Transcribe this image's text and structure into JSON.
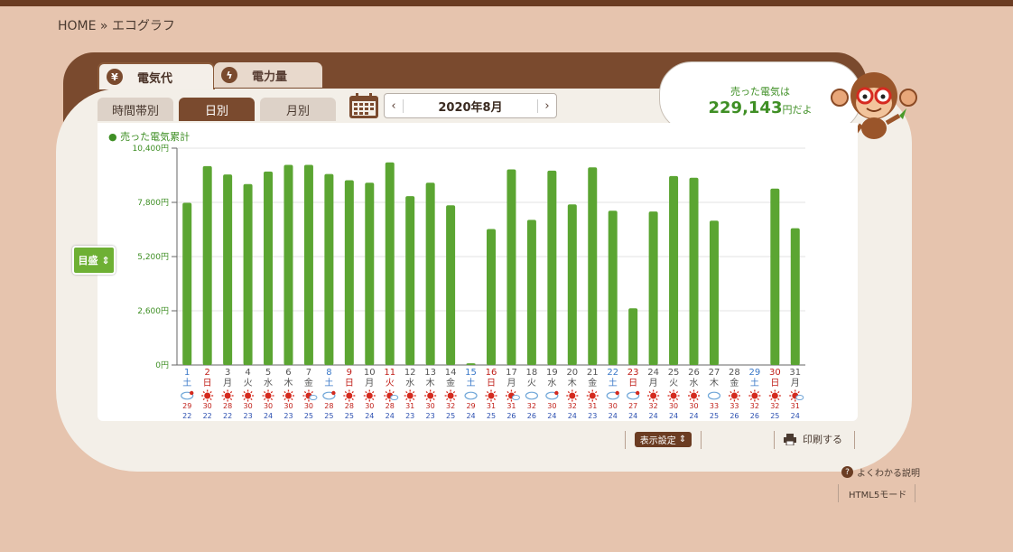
{
  "breadcrumb": "HOME » エコグラフ",
  "tabs": {
    "cost": "電気代",
    "power": "電力量",
    "cost_icon": "¥",
    "power_icon": "ϟ"
  },
  "subtabs": {
    "hourly": "時間帯別",
    "daily": "日別",
    "monthly": "月別"
  },
  "date": {
    "label": "2020年8月",
    "prev": "‹",
    "next": "›"
  },
  "legend": "売った電気累計",
  "meyasu": "目盛",
  "bubble": {
    "line1": "売った電気は",
    "amount": "229,143",
    "suffix": "円だよ"
  },
  "footer": {
    "settings": "表示設定",
    "print": "印刷する",
    "help": "よくわかる説明",
    "html5": "HTML5モード"
  },
  "colors": {
    "bar": "#5ba532",
    "brown": "#7a4a2e",
    "sun": "#d42a1e",
    "cloud": "#6fa6d8",
    "high": "#c0201a",
    "low": "#2b4fb0"
  },
  "chart_data": {
    "type": "bar",
    "series": [
      {
        "name": "売った電気累計",
        "values": [
          7780,
          9540,
          9140,
          8680,
          9280,
          9600,
          9600,
          9160,
          8860,
          8740,
          9720,
          8100,
          8740,
          7660,
          80,
          6520,
          9380,
          6960,
          9320,
          7700,
          9480,
          7400,
          2720,
          7360,
          9060,
          8980,
          6920,
          0,
          0,
          8460,
          6560
        ]
      }
    ],
    "categories": [
      "1",
      "2",
      "3",
      "4",
      "5",
      "6",
      "7",
      "8",
      "9",
      "10",
      "11",
      "12",
      "13",
      "14",
      "15",
      "16",
      "17",
      "18",
      "19",
      "20",
      "21",
      "22",
      "23",
      "24",
      "25",
      "26",
      "27",
      "28",
      "29",
      "30",
      "31"
    ],
    "weekdays": [
      "土",
      "日",
      "月",
      "火",
      "水",
      "木",
      "金",
      "土",
      "日",
      "月",
      "火",
      "水",
      "木",
      "金",
      "土",
      "日",
      "月",
      "火",
      "水",
      "木",
      "金",
      "土",
      "日",
      "月",
      "火",
      "水",
      "木",
      "金",
      "土",
      "日",
      "月"
    ],
    "day_colors": [
      "blue",
      "red",
      "normal",
      "normal",
      "normal",
      "normal",
      "normal",
      "blue",
      "red",
      "normal",
      "red",
      "normal",
      "normal",
      "normal",
      "blue",
      "red",
      "normal",
      "normal",
      "normal",
      "normal",
      "normal",
      "blue",
      "red",
      "normal",
      "normal",
      "normal",
      "normal",
      "normal",
      "blue",
      "red",
      "normal"
    ],
    "weather": [
      "cloud-sun",
      "sun",
      "sun",
      "sun",
      "sun",
      "sun",
      "sun-cloud",
      "cloud-sun",
      "sun",
      "sun",
      "sun-cloud",
      "sun",
      "sun",
      "sun",
      "cloud",
      "sun",
      "sun-cloud",
      "cloud",
      "cloud-sun",
      "sun",
      "sun",
      "cloud-sun",
      "cloud-sun",
      "sun",
      "sun",
      "sun",
      "cloud",
      "sun",
      "sun",
      "sun",
      "sun-cloud"
    ],
    "high_temps": [
      "29",
      "30",
      "28",
      "30",
      "30",
      "30",
      "30",
      "28",
      "28",
      "30",
      "28",
      "31",
      "30",
      "32",
      "29",
      "31",
      "31",
      "32",
      "30",
      "32",
      "31",
      "30",
      "27",
      "32",
      "30",
      "30",
      "33",
      "33",
      "32",
      "32",
      "31"
    ],
    "low_temps": [
      "22",
      "22",
      "22",
      "23",
      "24",
      "23",
      "25",
      "25",
      "25",
      "24",
      "24",
      "23",
      "23",
      "25",
      "24",
      "25",
      "26",
      "26",
      "24",
      "24",
      "23",
      "24",
      "24",
      "24",
      "24",
      "24",
      "25",
      "26",
      "26",
      "25",
      "24"
    ],
    "y_ticks": [
      "0円",
      "2,600円",
      "5,200円",
      "7,800円",
      "10,400円"
    ],
    "ylim": [
      0,
      10400
    ],
    "grid": true
  }
}
